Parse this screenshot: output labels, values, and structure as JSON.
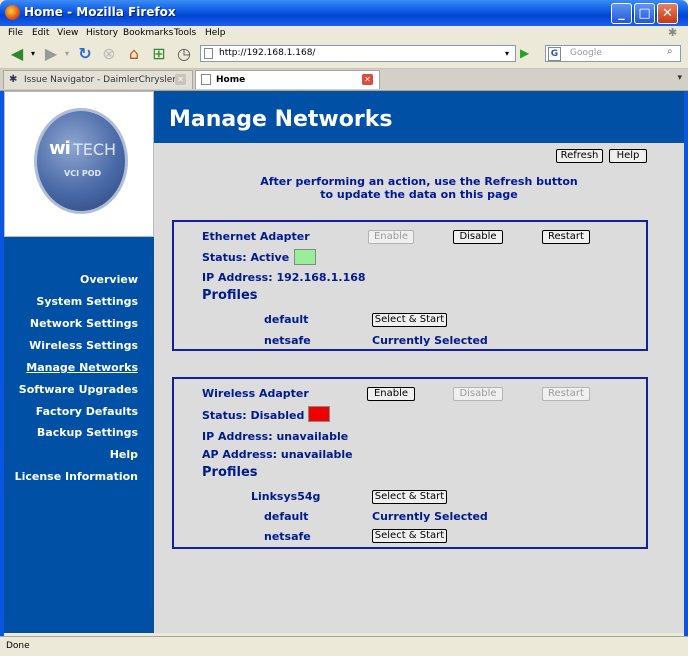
{
  "window": {
    "title": "Home - Mozilla Firefox"
  },
  "menu": [
    "File",
    "Edit",
    "View",
    "History",
    "Bookmarks",
    "Tools",
    "Help"
  ],
  "toolbar": {
    "url": "http://192.168.1.168/",
    "search_placeholder": "Google"
  },
  "tabs": [
    {
      "label": "Issue Navigator - DaimlerChrysler",
      "active": false
    },
    {
      "label": "Home",
      "active": true
    }
  ],
  "logo": {
    "brand_wi": "wi",
    "brand_tech": "TECH",
    "sub": "VCI POD"
  },
  "sidebar": {
    "items": [
      {
        "label": "Overview",
        "active": false
      },
      {
        "label": "System Settings",
        "active": false
      },
      {
        "label": "Network Settings",
        "active": false
      },
      {
        "label": "Wireless Settings",
        "active": false
      },
      {
        "label": "Manage Networks",
        "active": true
      },
      {
        "label": "Software Upgrades",
        "active": false
      },
      {
        "label": "Factory Defaults",
        "active": false
      },
      {
        "label": "Backup Settings",
        "active": false
      },
      {
        "label": "Help",
        "active": false
      },
      {
        "label": "License Information",
        "active": false
      }
    ]
  },
  "main": {
    "title": "Manage Networks",
    "refresh_label": "Refresh",
    "help_label": "Help",
    "info_line1": "After performing an action, use the Refresh button",
    "info_line2": "to update the data on this page"
  },
  "ethernet": {
    "title": "Ethernet Adapter",
    "enable_label": "Enable",
    "disable_label": "Disable",
    "restart_label": "Restart",
    "status": "Status: Active",
    "status_color": "#99ee99",
    "ip": "IP Address: 192.168.1.168",
    "profiles_heading": "Profiles",
    "profiles": [
      {
        "name": "default",
        "action": "Select & Start"
      },
      {
        "name": "netsafe",
        "action": "Currently Selected"
      }
    ]
  },
  "wireless": {
    "title": "Wireless Adapter",
    "enable_label": "Enable",
    "disable_label": "Disable",
    "restart_label": "Restart",
    "status": "Status: Disabled",
    "status_color": "#ee0000",
    "ip": "IP Address: unavailable",
    "ap": "AP Address: unavailable",
    "profiles_heading": "Profiles",
    "profiles": [
      {
        "name": "Linksys54g",
        "action": "Select & Start"
      },
      {
        "name": "default",
        "action": "Currently Selected"
      },
      {
        "name": "netsafe",
        "action": "Select & Start"
      }
    ]
  },
  "statusbar": {
    "text": "Done"
  }
}
